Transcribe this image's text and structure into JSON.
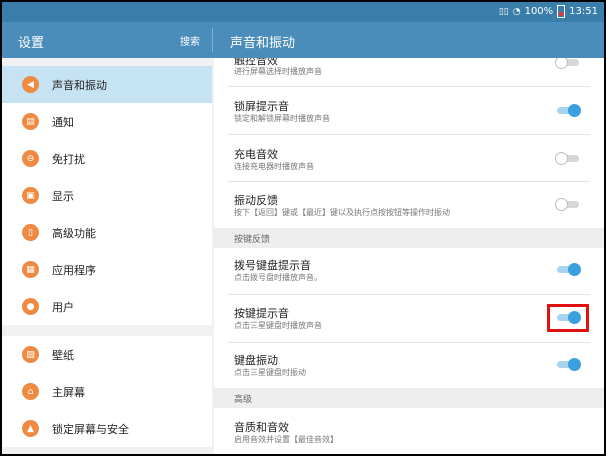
{
  "status_bar": {
    "battery_percent": "100%",
    "time": "13:51"
  },
  "header": {
    "title": "设置",
    "search_label": "搜索",
    "detail_title": "声音和振动"
  },
  "sidebar": {
    "groups": [
      [
        {
          "label": "声音和振动",
          "icon": "speaker-icon",
          "selected": true
        },
        {
          "label": "通知",
          "icon": "notification-icon"
        },
        {
          "label": "免打扰",
          "icon": "do-not-disturb-icon"
        },
        {
          "label": "显示",
          "icon": "display-icon"
        },
        {
          "label": "高级功能",
          "icon": "advanced-features-icon"
        },
        {
          "label": "应用程序",
          "icon": "apps-grid-icon"
        },
        {
          "label": "用户",
          "icon": "users-icon"
        }
      ],
      [
        {
          "label": "壁纸",
          "icon": "wallpaper-icon"
        },
        {
          "label": "主屏幕",
          "icon": "home-icon"
        },
        {
          "label": "锁定屏幕与安全",
          "icon": "lock-icon"
        }
      ]
    ]
  },
  "settings": [
    {
      "title": "触控音效",
      "subtitle": "进行屏幕选择时播放声音",
      "on": false
    },
    {
      "title": "锁屏提示音",
      "subtitle": "锁定和解锁屏幕时播放声音",
      "on": true
    },
    {
      "title": "充电音效",
      "subtitle": "连接充电器时播放声音",
      "on": false
    },
    {
      "title": "振动反馈",
      "subtitle": "按下【返回】键或【最近】键以及执行点按按钮等操作时振动",
      "on": false
    }
  ],
  "section_keyboard": "按键反馈",
  "keyboard_settings": [
    {
      "title": "拨号键盘提示音",
      "subtitle": "点击拨号盘时播放声音。",
      "on": true
    },
    {
      "title": "按键提示音",
      "subtitle": "点击三星键盘时播放声音",
      "on": true
    },
    {
      "title": "键盘振动",
      "subtitle": "点击三星键盘时振动",
      "on": true
    }
  ],
  "section_advanced": "高级",
  "advanced_settings": [
    {
      "title": "音质和音效",
      "subtitle": "启用音效并设置【最佳音效】"
    }
  ]
}
